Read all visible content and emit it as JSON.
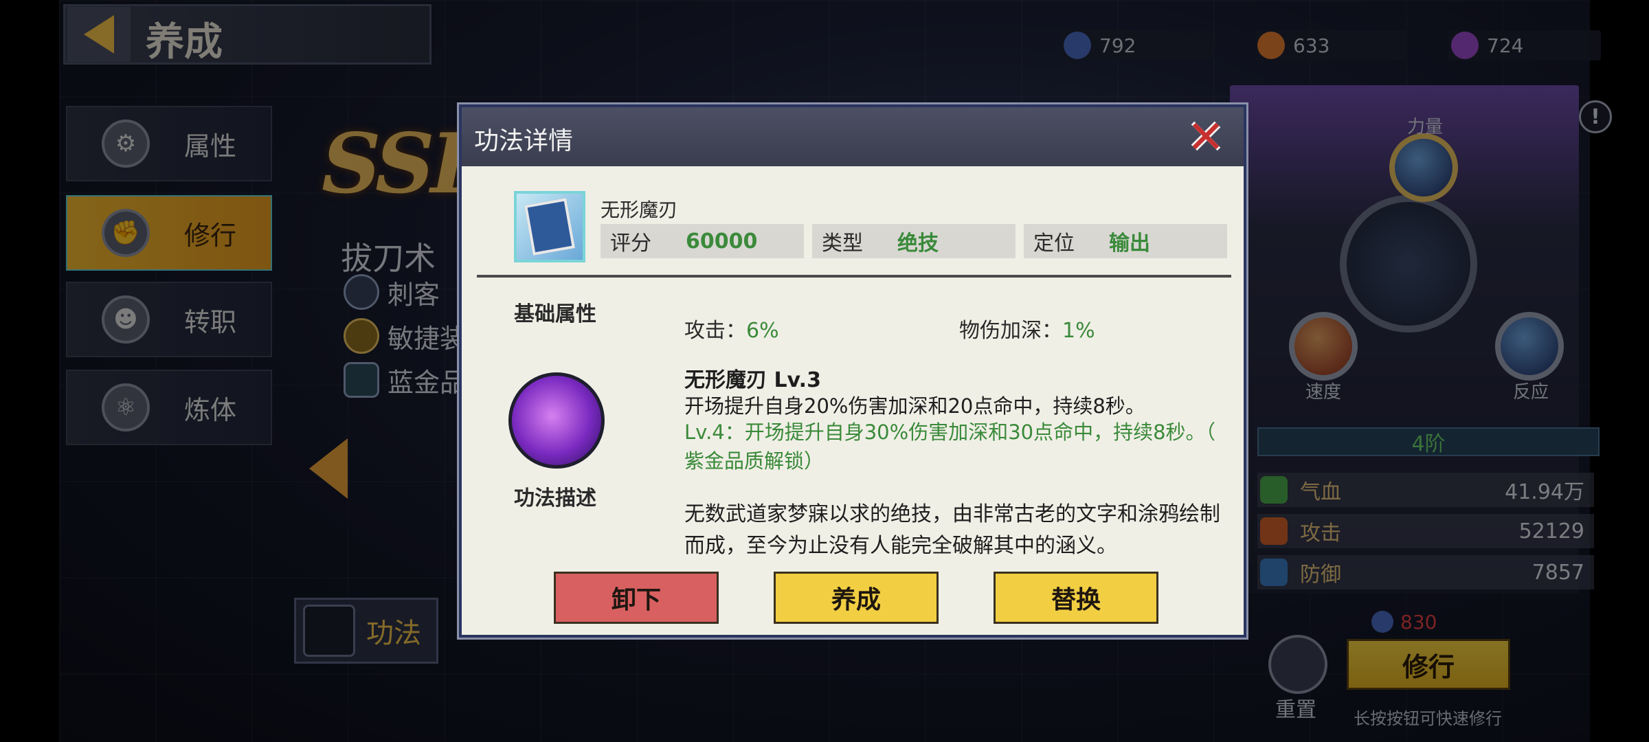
{
  "header": {
    "title": "养成",
    "currencies": [
      {
        "icon": "blue-gem-icon",
        "value": "792",
        "color": "#4a6ac0"
      },
      {
        "icon": "orange-coin-icon",
        "value": "633",
        "color": "#e07a30"
      },
      {
        "icon": "purple-orb-icon",
        "value": "724",
        "color": "#9a4ac8"
      }
    ]
  },
  "sidebar": {
    "items": [
      {
        "label": "属性",
        "icon": "gear-icon",
        "active": false
      },
      {
        "label": "修行",
        "icon": "fist-icon",
        "active": true
      },
      {
        "label": "转职",
        "icon": "person-icon",
        "active": false
      },
      {
        "label": "炼体",
        "icon": "atom-icon",
        "active": false
      }
    ]
  },
  "hero": {
    "rarity": "SSR",
    "name": "拔刀术",
    "tags": [
      "刺客",
      "敏捷装",
      "蓝金品"
    ],
    "gongfa_tab": "功法"
  },
  "right_panel": {
    "orbs": [
      "力量",
      "速度",
      "反应"
    ],
    "rank": "4阶",
    "stats": [
      {
        "label": "气血",
        "value": "41.94万",
        "icon": "heart-icon",
        "color": "#4aa84a"
      },
      {
        "label": "攻击",
        "value": "52129",
        "icon": "attack-icon",
        "color": "#d0602a"
      },
      {
        "label": "防御",
        "value": "7857",
        "icon": "shield-icon",
        "color": "#3a7ac0"
      }
    ],
    "cost": "830",
    "reset_label": "重置",
    "train_label": "修行",
    "train_hint": "长按按钮可快速修行",
    "info_mark": "!"
  },
  "modal": {
    "title": "功法详情",
    "skill_name": "无形魔刃",
    "info": [
      {
        "key": "评分",
        "value": "60000"
      },
      {
        "key": "类型",
        "value": "绝技"
      },
      {
        "key": "定位",
        "value": "输出"
      }
    ],
    "base_attr_title": "基础属性",
    "base_attrs": [
      {
        "key": "攻击：",
        "value": "6%"
      },
      {
        "key": "物伤加深：",
        "value": "1%"
      }
    ],
    "desc_title": "功法描述",
    "level_title": "无形魔刃  Lv.3",
    "level_desc": "开场提升自身20%伤害加深和20点命中，持续8秒。",
    "next_level_desc_1": "Lv.4：开场提升自身30%伤害加深和30点命中，持续8秒。（",
    "next_level_desc_2": "紫金品质解锁）",
    "lore": "无数武道家梦寐以求的绝技，由非常古老的文字和涂鸦绘制而成，至今为止没有人能完全破解其中的涵义。",
    "buttons": {
      "unequip": "卸下",
      "cultivate": "养成",
      "replace": "替换"
    }
  }
}
